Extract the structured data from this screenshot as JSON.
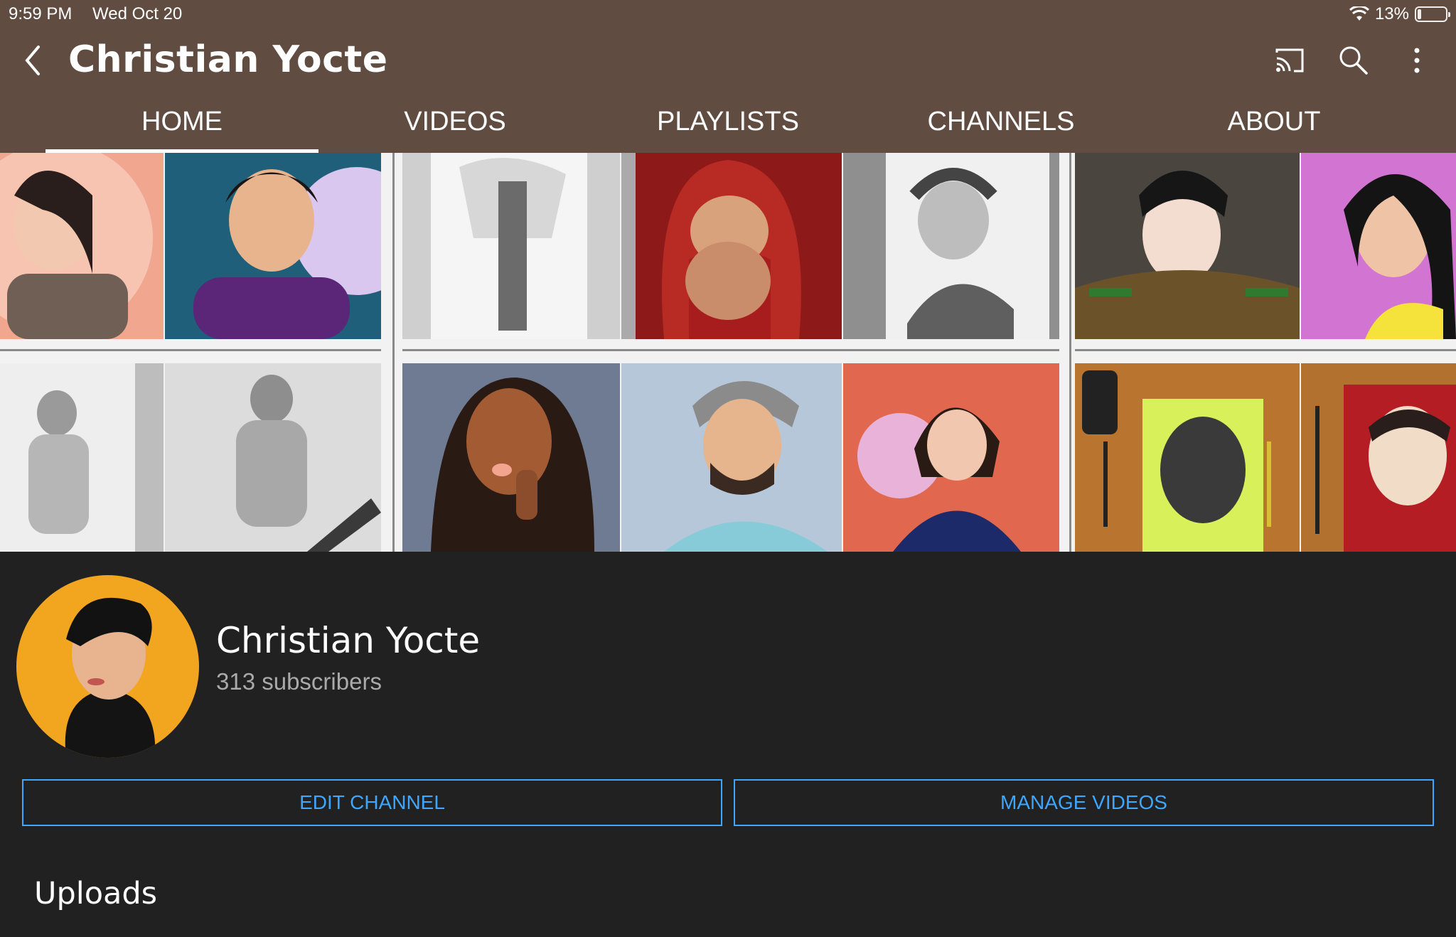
{
  "status": {
    "time": "9:59 PM",
    "date": "Wed Oct 20",
    "battery": "13%",
    "battery_level": 0.13
  },
  "toolbar": {
    "title": "Christian Yocte",
    "icons": [
      "back-icon",
      "cast-icon",
      "search-icon",
      "more-vert-icon"
    ]
  },
  "tabs": [
    {
      "label": "HOME",
      "active": true
    },
    {
      "label": "VIDEOS",
      "active": false
    },
    {
      "label": "PLAYLISTS",
      "active": false
    },
    {
      "label": "CHANNELS",
      "active": false
    },
    {
      "label": "ABOUT",
      "active": false
    }
  ],
  "channel": {
    "name": "Christian Yocte",
    "subscribers": "313 subscribers"
  },
  "actions": {
    "edit": "EDIT CHANNEL",
    "manage": "MANAGE VIDEOS"
  },
  "section": {
    "uploads": "Uploads"
  },
  "colors": {
    "header": "#604c40",
    "background": "#212121",
    "accent": "#3ea6ff"
  }
}
